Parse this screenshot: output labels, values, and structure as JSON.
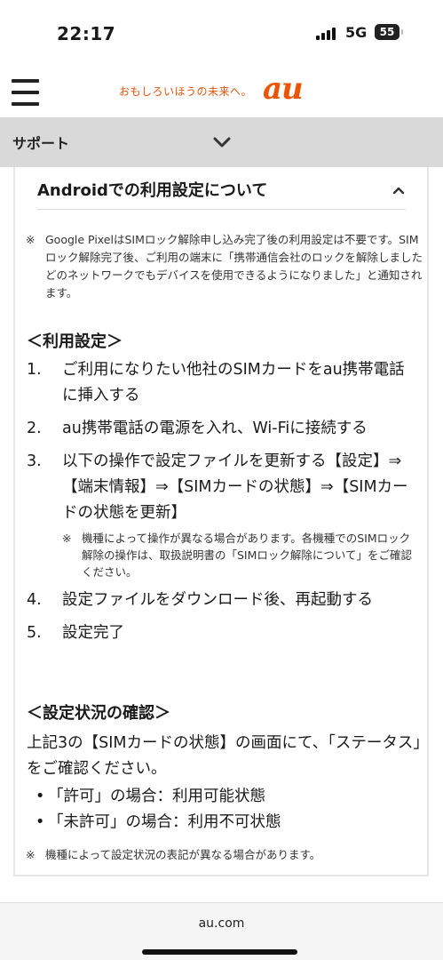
{
  "status": {
    "time": "22:17",
    "network": "5G",
    "battery": "55"
  },
  "header": {
    "tagline": "おもしろいほうの未来へ。",
    "logo": "au",
    "menu_icon": "hamburger-icon"
  },
  "support": {
    "label": "サポート",
    "icon": "chevron-down-icon"
  },
  "accordion": {
    "title": "Androidでの利用設定について",
    "icon": "chevron-up-icon"
  },
  "top_note": {
    "mark": "※",
    "text": "Google PixelはSIMロック解除申し込み完了後の利用設定は不要です。SIMロック解除完了後、ご利用の端末に「携帯通信会社のロックを解除しました どのネットワークでもデバイスを使用できるようになりました」と通知されます。"
  },
  "usage_heading": "＜利用設定＞",
  "steps": [
    {
      "num": "1.",
      "text": "ご利用になりたい他社のSIMカードをau携帯電話に挿入する"
    },
    {
      "num": "2.",
      "text": "au携帯電話の電源を入れ、Wi-Fiに接続する"
    },
    {
      "num": "3.",
      "text": "以下の操作で設定ファイルを更新する【設定】⇒【端末情報】⇒【SIMカードの状態】⇒【SIMカードの状態を更新】"
    },
    {
      "num": "4.",
      "text": "設定ファイルをダウンロード後、再起動する"
    },
    {
      "num": "5.",
      "text": "設定完了"
    }
  ],
  "step3_note": {
    "mark": "※",
    "text": "機種によって操作が異なる場合があります。各機種でのSIMロック解除の操作は、取扱説明書の「SIMロック解除について」をご確認ください。"
  },
  "status_heading": "＜設定状況の確認＞",
  "status_text": "上記3の【SIMカードの状態】の画面にて、「ステータス」をご確認ください。",
  "status_bullets": [
    "「許可」の場合：利用可能状態",
    "「未許可」の場合：利用不可状態"
  ],
  "bottom_note": {
    "mark": "※",
    "text": "機種によって設定状況の表記が異なる場合があります。"
  },
  "footer": {
    "url": "au.com"
  }
}
